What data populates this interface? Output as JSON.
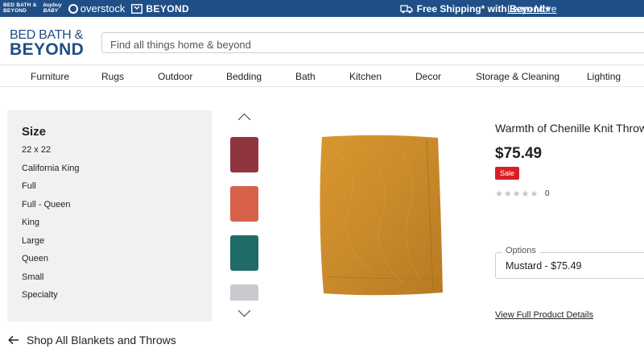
{
  "topbar": {
    "brands": {
      "bbb_line1": "BED BATH &",
      "bbb_line2": "BEYOND",
      "bbaby_line1": "buybuy",
      "bbaby_line2": "BABY",
      "overstock": "overstock",
      "beyond": "BEYOND"
    },
    "shipping_text": "Free Shipping* with Beyond+",
    "learn_more": "Learn More",
    "bg_color": "#1f4f86"
  },
  "header": {
    "logo_line1": "BED BATH &",
    "logo_line2": "BEYOND",
    "search_placeholder": "Find all things home & beyond"
  },
  "nav": {
    "items": [
      "Furniture",
      "Rugs",
      "Outdoor",
      "Bedding",
      "Bath",
      "Kitchen",
      "Decor",
      "Storage & Cleaning",
      "Lighting"
    ]
  },
  "filter": {
    "title": "Size",
    "options": [
      "22 x 22",
      "California King",
      "Full",
      "Full - Queen",
      "King",
      "Large",
      "Queen",
      "Small",
      "Specialty"
    ]
  },
  "gallery": {
    "thumbnail_colors": [
      "#8f3540",
      "#d8614a",
      "#1f6b66",
      "#c9cad0"
    ],
    "main_color": "#c98a2a"
  },
  "product": {
    "title": "Warmth of Chenille Knit Throw",
    "price": "$75.49",
    "sale_badge": "Sale",
    "rating_stars": 0,
    "review_count": "0",
    "options_label": "Options",
    "options_value": "Mustard - $75.49",
    "details_link": "View Full Product Details"
  },
  "back_link": "Shop All Blankets and Throws",
  "icons": {
    "free_shipping": "truck-icon",
    "back": "arrow-left-icon",
    "gallery_up": "chevron-up-icon",
    "gallery_down": "chevron-down-icon"
  }
}
